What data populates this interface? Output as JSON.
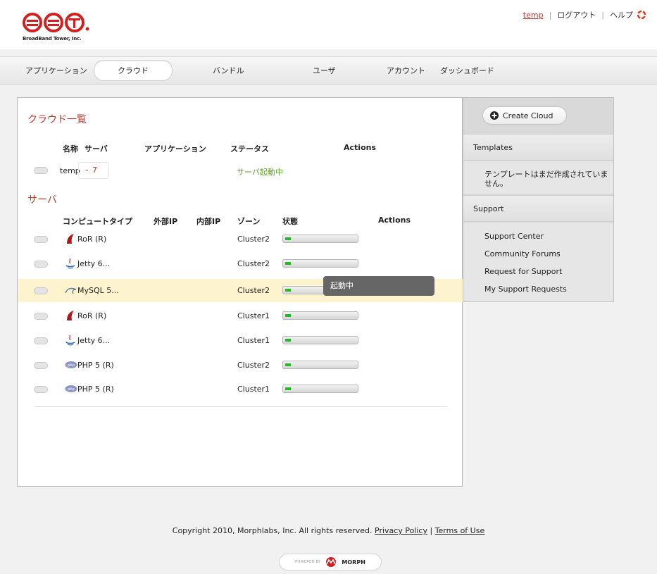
{
  "header": {
    "logo_text": "BroadBand Tower, Inc.",
    "user_link": "temp",
    "logout": "ログアウト",
    "help": "ヘルプ",
    "brand_color": "#d21f1f"
  },
  "nav": {
    "items": [
      "アプリケーション",
      "クラウド",
      "バンドル",
      "ユーザ",
      "アカウント",
      "ダッシュボード"
    ],
    "active_index": 1
  },
  "cloud_list": {
    "title": "クラウド一覧",
    "headers": {
      "name": "名称",
      "servers": "サーバ",
      "applications": "アプリケーション",
      "status": "ステータス",
      "actions": "Actions"
    },
    "rows": [
      {
        "name": "temp",
        "servers": "7",
        "status": "サーバ起動中",
        "status_color": "#5a9e1d"
      }
    ]
  },
  "servers": {
    "title": "サーバ",
    "headers": {
      "compute_type": "コンピュートタイプ",
      "external_ip": "外部IP",
      "internal_ip": "内部IP",
      "zone": "ゾーン",
      "state": "状態",
      "actions": "Actions"
    },
    "rows": [
      {
        "type": "RoR (R)",
        "icon": "rails-icon",
        "zone": "Cluster2",
        "progress": 0.08,
        "highlight": false
      },
      {
        "type": "Jetty 6...",
        "icon": "java-icon",
        "zone": "Cluster2",
        "progress": 0.08,
        "highlight": false
      },
      {
        "type": "MySQL 5...",
        "icon": "mysql-icon",
        "zone": "Cluster2",
        "progress": 0.08,
        "highlight": true
      },
      {
        "type": "RoR (R)",
        "icon": "rails-icon",
        "zone": "Cluster1",
        "progress": 0.08,
        "highlight": false
      },
      {
        "type": "Jetty 6...",
        "icon": "java-icon",
        "zone": "Cluster1",
        "progress": 0.08,
        "highlight": false
      },
      {
        "type": "PHP 5 (R)",
        "icon": "php-icon",
        "zone": "Cluster2",
        "progress": 0.08,
        "highlight": false
      },
      {
        "type": "PHP 5 (R)",
        "icon": "php-icon",
        "zone": "Cluster1",
        "progress": 0.08,
        "highlight": false
      }
    ],
    "tooltip": "起動中"
  },
  "sidebar": {
    "create_button": "Create Cloud",
    "templates_head": "Templates",
    "templates_empty": "テンプレートはまだ作成されていません。",
    "support_head": "Support",
    "support_links": [
      "Support Center",
      "Community Forums",
      "Request for Support",
      "My Support Requests"
    ]
  },
  "footer": {
    "copyright": "Copyright 2010, Morphlabs, Inc. All rights reserved.",
    "privacy": "Privacy Policy",
    "separator": "|",
    "terms": "Terms of Use",
    "powered_by": "POWERED BY",
    "brand": "MORPH"
  }
}
